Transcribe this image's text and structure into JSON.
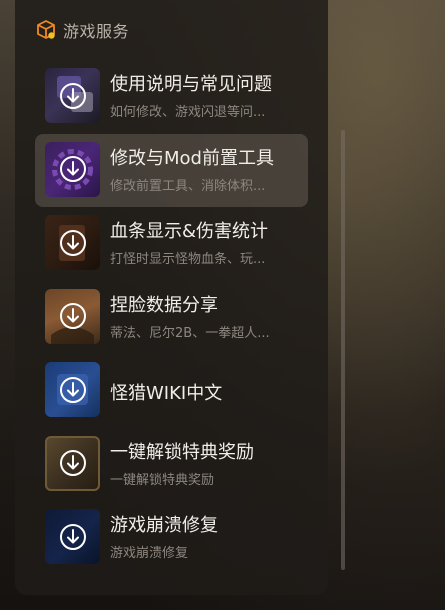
{
  "panel": {
    "title": "游戏服务",
    "header_icon": "cube-icon",
    "accent_color": "#f08a24"
  },
  "items": [
    {
      "title": "使用说明与常见问题",
      "subtitle": "如何修改、游戏闪退等问...",
      "icon": "download-icon"
    },
    {
      "title": "修改与Mod前置工具",
      "subtitle": "修改前置工具、消除体积...",
      "icon": "download-icon",
      "selected": true
    },
    {
      "title": "血条显示&伤害统计",
      "subtitle": "打怪时显示怪物血条、玩...",
      "icon": "download-icon"
    },
    {
      "title": "捏脸数据分享",
      "subtitle": "蒂法、尼尔2B、一拳超人...",
      "icon": "download-icon"
    },
    {
      "title": "怪猎WIKI中文",
      "subtitle": "",
      "icon": "download-icon"
    },
    {
      "title": "一键解锁特典奖励",
      "subtitle": "一键解锁特典奖励",
      "icon": "download-icon"
    },
    {
      "title": "游戏崩溃修复",
      "subtitle": "游戏崩溃修复",
      "icon": "download-icon"
    }
  ]
}
